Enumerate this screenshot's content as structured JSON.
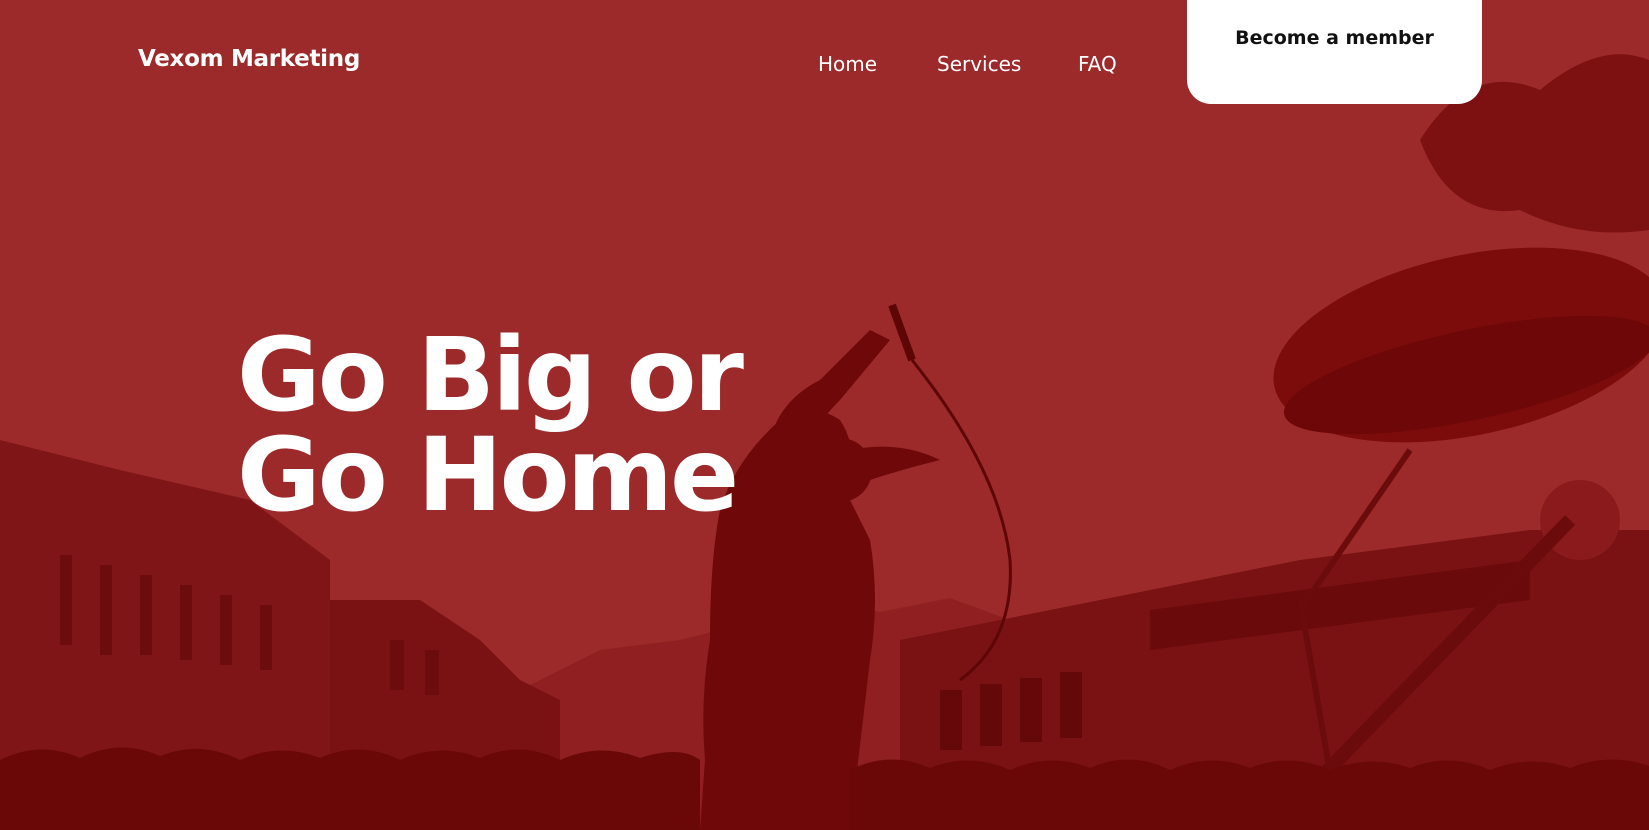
{
  "brand": {
    "name": "Vexom Marketing"
  },
  "nav": {
    "links": [
      {
        "label": "Home"
      },
      {
        "label": "Services"
      },
      {
        "label": "FAQ"
      }
    ],
    "cta_label": "Become a member"
  },
  "hero": {
    "headline_line1": "Go Big or",
    "headline_line2": "Go Home",
    "background_image": "concert-singer-crowd-red-tint"
  },
  "colors": {
    "overlay": "#9c2a2b",
    "overlay_dark": "#7a0f10",
    "text": "#ffffff",
    "cta_bg": "#ffffff",
    "cta_text": "#111111"
  }
}
